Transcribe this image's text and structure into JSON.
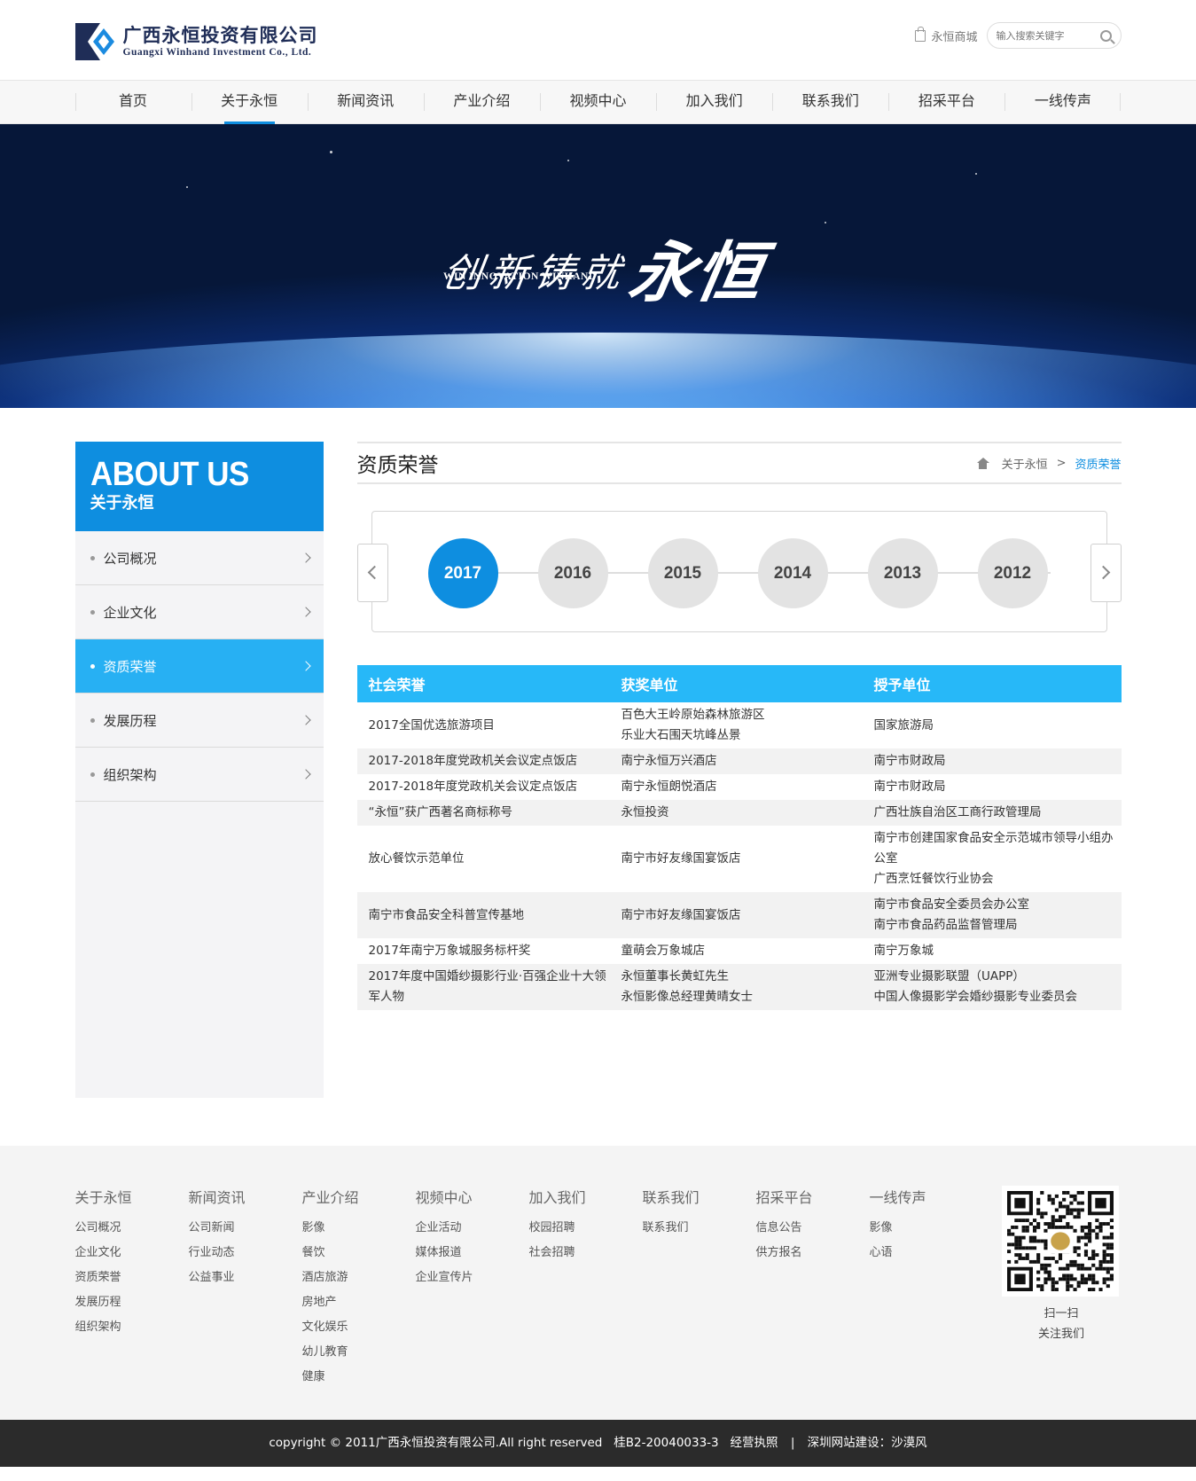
{
  "header": {
    "logo_cn": "广西永恒投资有限公司",
    "logo_en": "Guangxi Winhand Investment Co., Ltd.",
    "shop_label": "永恒商城",
    "search_placeholder": "输入搜索关键字"
  },
  "nav": [
    "首页",
    "关于永恒",
    "新闻资讯",
    "产业介绍",
    "视频中心",
    "加入我们",
    "联系我们",
    "招采平台",
    "一线传声"
  ],
  "nav_active": "关于永恒",
  "banner": {
    "slogan_cn": "创新铸就",
    "slogan_cn2": "永恒",
    "slogan_en": "WIN INNOVATION WINHAND"
  },
  "sidebar": {
    "title_en": "ABOUT US",
    "title_cn": "关于永恒",
    "items": [
      {
        "label": "公司概况"
      },
      {
        "label": "企业文化"
      },
      {
        "label": "资质荣誉"
      },
      {
        "label": "发展历程"
      },
      {
        "label": "组织架构"
      }
    ],
    "active": "资质荣誉"
  },
  "page": {
    "title": "资质荣誉",
    "breadcrumb": [
      "关于永恒",
      "资质荣誉"
    ],
    "breadcrumb_sep": ">"
  },
  "years": [
    "2017",
    "2016",
    "2015",
    "2014",
    "2013",
    "2012"
  ],
  "active_year": "2017",
  "table": {
    "headers": [
      "社会荣誉",
      "获奖单位",
      "授予单位"
    ],
    "rows": [
      {
        "honor": [
          "2017全国优选旅游项目"
        ],
        "winner": [
          "百色大王岭原始森林旅游区",
          "乐业大石围天坑峰丛景"
        ],
        "grantor": [
          "国家旅游局"
        ]
      },
      {
        "honor": [
          "2017-2018年度党政机关会议定点饭店"
        ],
        "winner": [
          "南宁永恒万兴酒店"
        ],
        "grantor": [
          "南宁市财政局"
        ]
      },
      {
        "honor": [
          "2017-2018年度党政机关会议定点饭店"
        ],
        "winner": [
          "南宁永恒朗悦酒店"
        ],
        "grantor": [
          "南宁市财政局"
        ]
      },
      {
        "honor": [
          "“永恒”获广西著名商标称号"
        ],
        "winner": [
          "永恒投资"
        ],
        "grantor": [
          "广西壮族自治区工商行政管理局"
        ]
      },
      {
        "honor": [
          "放心餐饮示范单位"
        ],
        "winner": [
          "南宁市好友缘国宴饭店"
        ],
        "grantor": [
          "南宁市创建国家食品安全示范城市领导小组办公室",
          "广西烹饪餐饮行业协会"
        ]
      },
      {
        "honor": [
          "南宁市食品安全科普宣传基地"
        ],
        "winner": [
          "南宁市好友缘国宴饭店"
        ],
        "grantor": [
          "南宁市食品安全委员会办公室",
          "南宁市食品药品监督管理局"
        ]
      },
      {
        "honor": [
          "2017年南宁万象城服务标杆奖"
        ],
        "winner": [
          "童萌会万象城店"
        ],
        "grantor": [
          "南宁万象城"
        ]
      },
      {
        "honor": [
          "2017年度中国婚纱摄影行业·百强企业十大领军人物"
        ],
        "winner": [
          "永恒董事长黄虹先生",
          "永恒影像总经理黄晴女士"
        ],
        "grantor": [
          "亚洲专业摄影联盟（UAPP）",
          "中国人像摄影学会婚纱摄影专业委员会"
        ]
      }
    ]
  },
  "footer": {
    "columns": [
      {
        "title": "关于永恒",
        "links": [
          "公司概况",
          "企业文化",
          "资质荣誉",
          "发展历程",
          "组织架构"
        ]
      },
      {
        "title": "新闻资讯",
        "links": [
          "公司新闻",
          "行业动态",
          "公益事业"
        ]
      },
      {
        "title": "产业介绍",
        "links": [
          "影像",
          "餐饮",
          "酒店旅游",
          "房地产",
          "文化娱乐",
          "幼儿教育",
          "健康"
        ]
      },
      {
        "title": "视频中心",
        "links": [
          "企业活动",
          "媒体报道",
          "企业宣传片"
        ]
      },
      {
        "title": "加入我们",
        "links": [
          "校园招聘",
          "社会招聘"
        ]
      },
      {
        "title": "联系我们",
        "links": [
          "联系我们"
        ]
      },
      {
        "title": "招采平台",
        "links": [
          "信息公告",
          "供方报名"
        ]
      },
      {
        "title": "一线传声",
        "links": [
          "影像",
          "心语"
        ]
      }
    ],
    "qr_line1": "扫一扫",
    "qr_line2": "关注我们",
    "copyright": "copyright © 2011广西永恒投资有限公司.All right reserved",
    "icp": "桂B2-20040033-3",
    "license": "经营执照",
    "builder": "深圳网站建设：沙漠风",
    "sep": "|"
  },
  "colors": {
    "primary": "#0e8ee0",
    "table_header": "#27b8f8",
    "sidebar_active": "#27b0f3",
    "footer_dark": "#2b2b2b"
  }
}
